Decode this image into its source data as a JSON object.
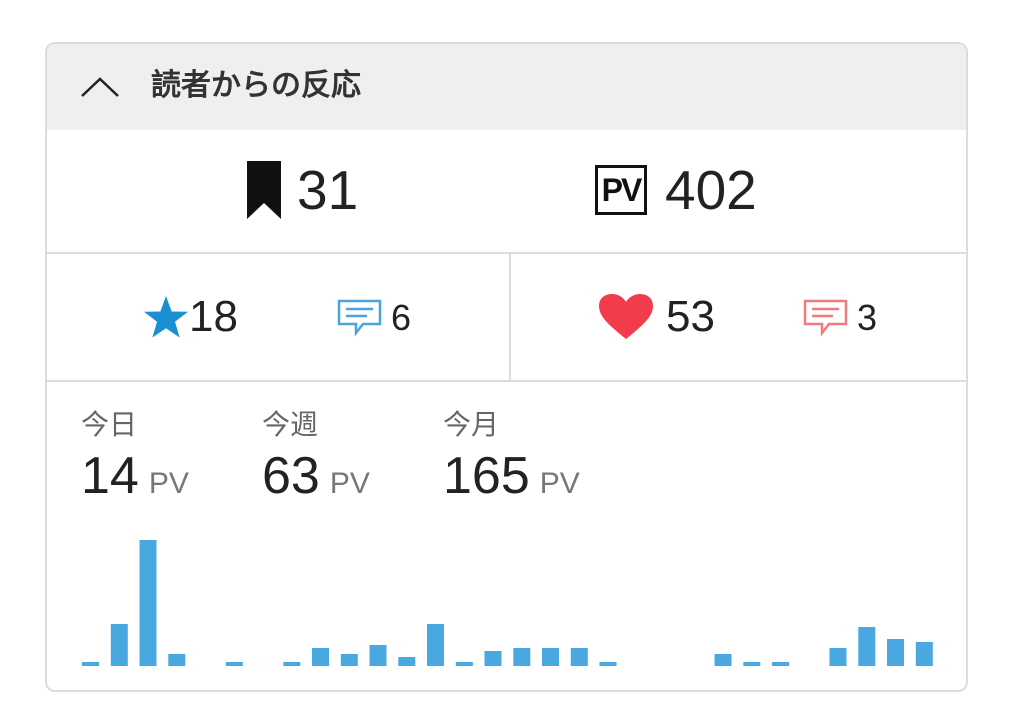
{
  "header": {
    "title": "読者からの反応",
    "toggle_icon": "chevron-up-icon"
  },
  "summary": {
    "bookmarks": "31",
    "pv_badge": "PV",
    "pv": "402"
  },
  "reactions": {
    "stars": "18",
    "star_comments": "6",
    "hearts": "53",
    "heart_comments": "3",
    "colors": {
      "star": "#1a8fd1",
      "star_comment": "#4aa3df",
      "heart": "#f23c4b",
      "heart_comment": "#f07a7d"
    }
  },
  "periods": [
    {
      "label": "今日",
      "value": "14",
      "unit": "PV"
    },
    {
      "label": "今週",
      "value": "63",
      "unit": "PV"
    },
    {
      "label": "今月",
      "value": "165",
      "unit": "PV"
    }
  ],
  "chart_data": {
    "type": "bar",
    "color": "#4aa8e0",
    "values": [
      1,
      14,
      42,
      4,
      0,
      1,
      0,
      1,
      6,
      4,
      7,
      3,
      14,
      1,
      5,
      6,
      6,
      6,
      1,
      0,
      0,
      0,
      4,
      1,
      1,
      0,
      6,
      13,
      9,
      8
    ]
  }
}
